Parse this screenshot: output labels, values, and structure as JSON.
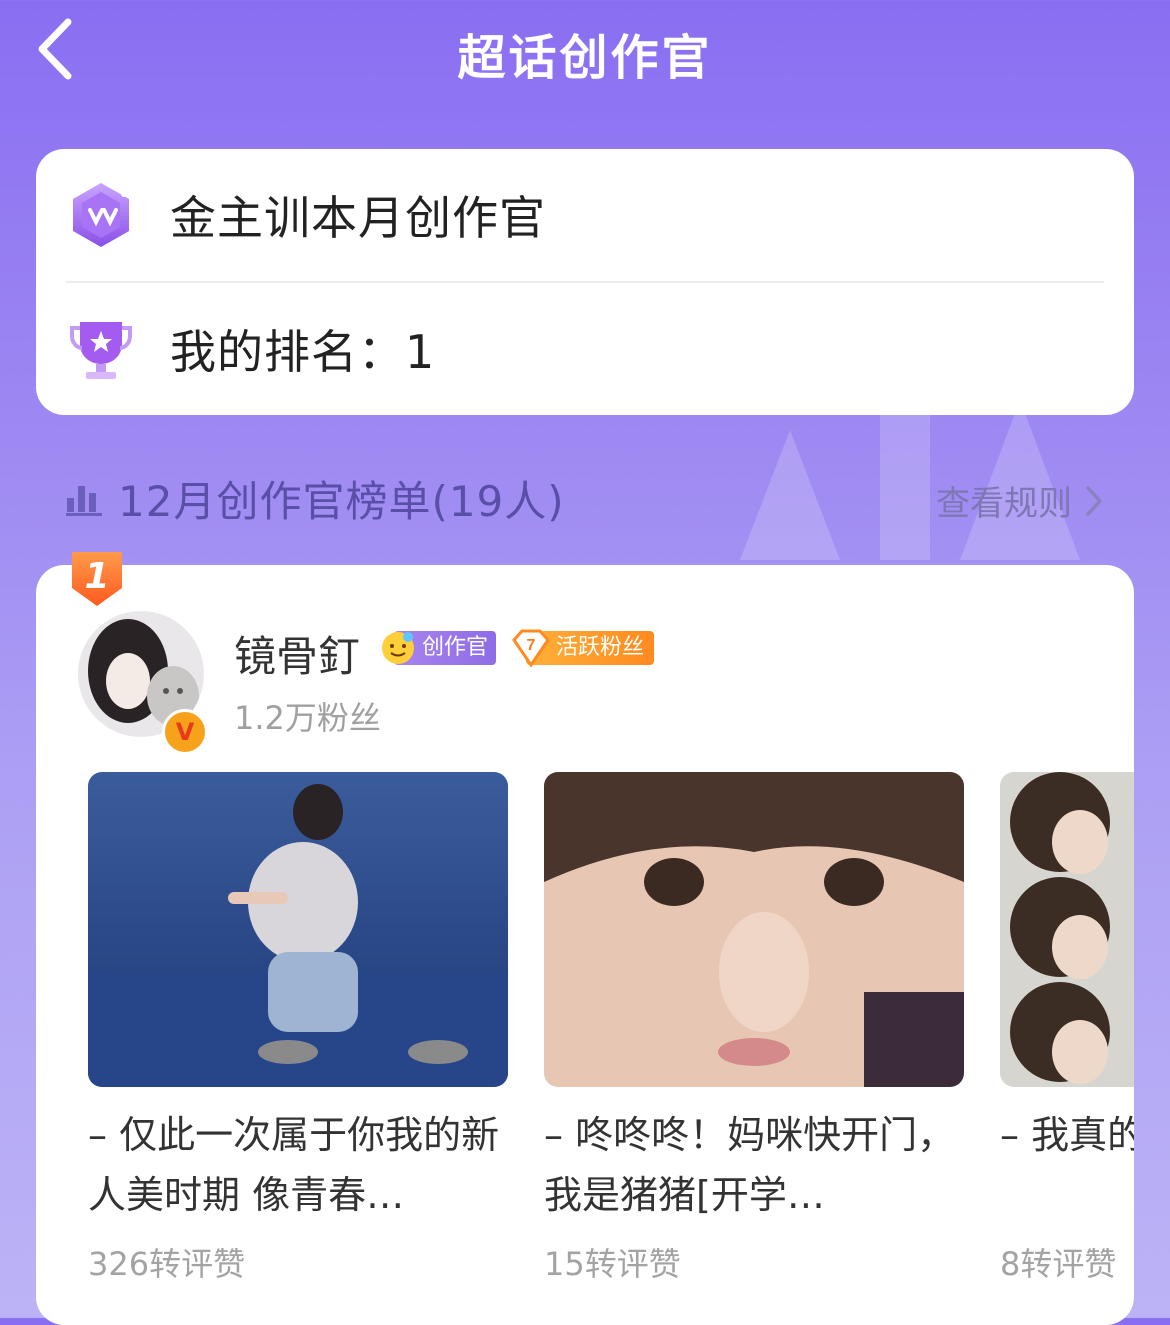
{
  "header": {
    "title": "超话创作官"
  },
  "info_card": {
    "creator_title": "金主训本月创作官",
    "my_rank": "我的排名：1"
  },
  "section": {
    "title": "12月创作官榜单(19人)",
    "rules_link": "查看规则"
  },
  "leaderboard": [
    {
      "rank": "1",
      "name": "镜骨釘",
      "badge_creator": "创作官",
      "badge_fan_level": "7",
      "badge_fan": "活跃粉丝",
      "followers": "1.2万粉丝",
      "posts": [
        {
          "text": "– 仅此一次属于你我的新人美时期 像青春…",
          "stats": "326转评赞"
        },
        {
          "text": "– 咚咚咚！妈咪快开门，我是猪猪[开学…",
          "stats": "15转评赞"
        },
        {
          "text": "– 我真的撅嘴撒娇",
          "stats": "8转评赞"
        }
      ]
    }
  ],
  "colors": {
    "accent_purple": "#8a6ef2",
    "rank_orange": "#ff7a2a",
    "verified_orange": "#f7a21b"
  }
}
